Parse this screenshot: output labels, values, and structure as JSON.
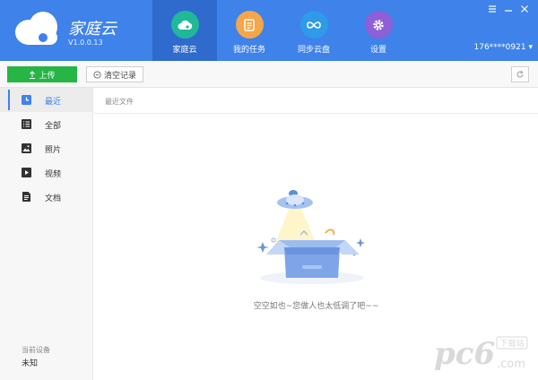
{
  "app": {
    "name": "家庭云",
    "version": "V1.0.0.13"
  },
  "nav": [
    {
      "label": "家庭云",
      "icon": "cloud-icon",
      "color": "#1fb99a"
    },
    {
      "label": "我的任务",
      "icon": "task-list-icon",
      "color": "#f4a64a"
    },
    {
      "label": "同步云盘",
      "icon": "sync-icon",
      "color": "#2d9be8"
    },
    {
      "label": "设置",
      "icon": "gear-icon",
      "color": "#8e5fd6"
    }
  ],
  "user": {
    "phone": "176****0921"
  },
  "toolbar": {
    "upload_label": "上传",
    "clear_label": "清空记录"
  },
  "sidebar": {
    "items": [
      {
        "label": "最近",
        "icon": "recent-icon"
      },
      {
        "label": "全部",
        "icon": "list-icon"
      },
      {
        "label": "照片",
        "icon": "image-icon"
      },
      {
        "label": "视频",
        "icon": "video-icon"
      },
      {
        "label": "文档",
        "icon": "document-icon"
      }
    ],
    "device_label": "当前设备",
    "device_value": "未知"
  },
  "main": {
    "section_title": "最近文件",
    "empty_text": "空空如也~您做人也太低调了吧~~"
  },
  "watermark": {
    "text": "pc6",
    "badge": "下载站",
    "domain": ".com"
  },
  "colors": {
    "header": "#3e82ea",
    "accent": "#3e82ea",
    "upload": "#27b545"
  }
}
